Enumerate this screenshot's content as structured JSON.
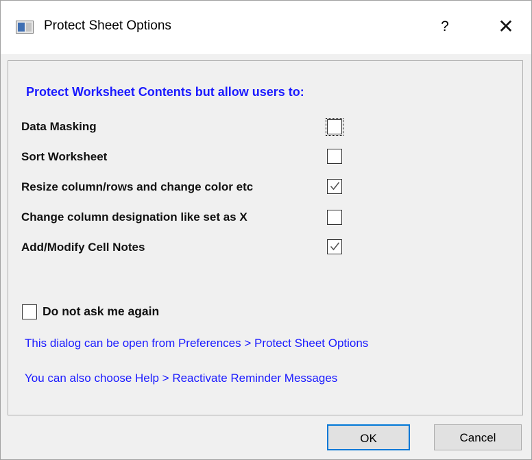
{
  "window": {
    "title": "Protect Sheet Options",
    "help_label": "?",
    "close_label": "✕",
    "icon": "app-window-icon"
  },
  "panel": {
    "heading": "Protect Worksheet Contents but allow users to:",
    "options": [
      {
        "label": "Data Masking",
        "checked": false
      },
      {
        "label": "Sort Worksheet",
        "checked": false
      },
      {
        "label": "Resize column/rows and change color etc",
        "checked": true
      },
      {
        "label": "Change column designation like set as X",
        "checked": false
      },
      {
        "label": "Add/Modify Cell Notes",
        "checked": true
      }
    ],
    "dont_ask": {
      "label": "Do not ask me again",
      "checked": false
    },
    "info_lines": [
      "This dialog can be open from Preferences > Protect Sheet Options",
      "You can also choose Help > Reactivate Reminder Messages"
    ]
  },
  "buttons": {
    "ok": "OK",
    "cancel": "Cancel"
  },
  "colors": {
    "heading": "#1a1aff",
    "info": "#1a1aff",
    "default_button_border": "#0078d7",
    "tick": "#555555"
  }
}
